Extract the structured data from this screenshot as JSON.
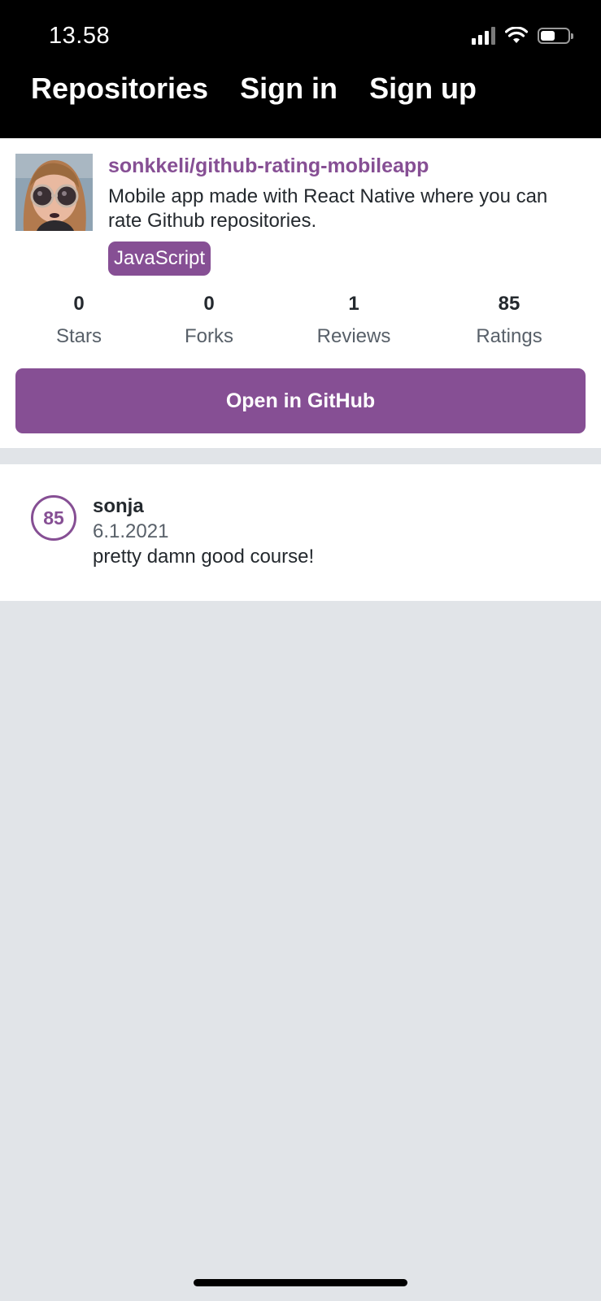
{
  "status_bar": {
    "time": "13.58"
  },
  "app_bar": {
    "tabs": [
      {
        "label": "Repositories"
      },
      {
        "label": "Sign in"
      },
      {
        "label": "Sign up"
      }
    ]
  },
  "repository": {
    "full_name": "sonkkeli/github-rating-mobileapp",
    "description": "Mobile app made with React Native where you can rate Github repositories.",
    "language": "JavaScript",
    "stats": [
      {
        "value": "0",
        "label": "Stars"
      },
      {
        "value": "0",
        "label": "Forks"
      },
      {
        "value": "1",
        "label": "Reviews"
      },
      {
        "value": "85",
        "label": "Ratings"
      }
    ],
    "open_button_label": "Open in GitHub"
  },
  "reviews": [
    {
      "rating": "85",
      "username": "sonja",
      "date": "6.1.2021",
      "text": "pretty damn good course!"
    }
  ],
  "theme": {
    "primary": "#864f94",
    "text_primary": "#24292e",
    "text_secondary": "#586069",
    "background": "#e1e4e8",
    "app_bar": "#000000"
  },
  "icons": [
    "signal-icon",
    "wifi-icon",
    "battery-icon",
    "avatar-image"
  ]
}
